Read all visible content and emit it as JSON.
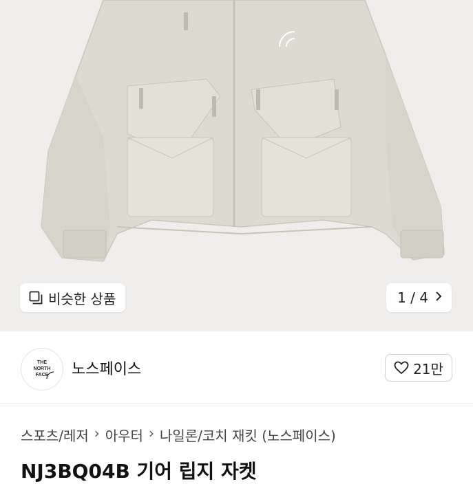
{
  "product_image": {
    "brand_mark": "THE NORTH FACE"
  },
  "overlay": {
    "similar_label": "비슷한 상품",
    "pager": "1 / 4"
  },
  "brand": {
    "logo_text": "THE NORTH FACE",
    "name": "노스페이스",
    "likes": "21만"
  },
  "breadcrumb": [
    "스포츠/레저",
    "아우터",
    "나일론/코치 재킷 (노스페이스)"
  ],
  "product": {
    "title": "NJ3BQ04B 기어 립지 자켓"
  },
  "icons": {
    "similar": "stacked-squares-icon",
    "next": "chevron-right-icon",
    "like": "heart-outline-icon",
    "separator": "chevron-right-icon"
  },
  "colors": {
    "jacket": "#dddbd1",
    "background": "#efeeec"
  }
}
